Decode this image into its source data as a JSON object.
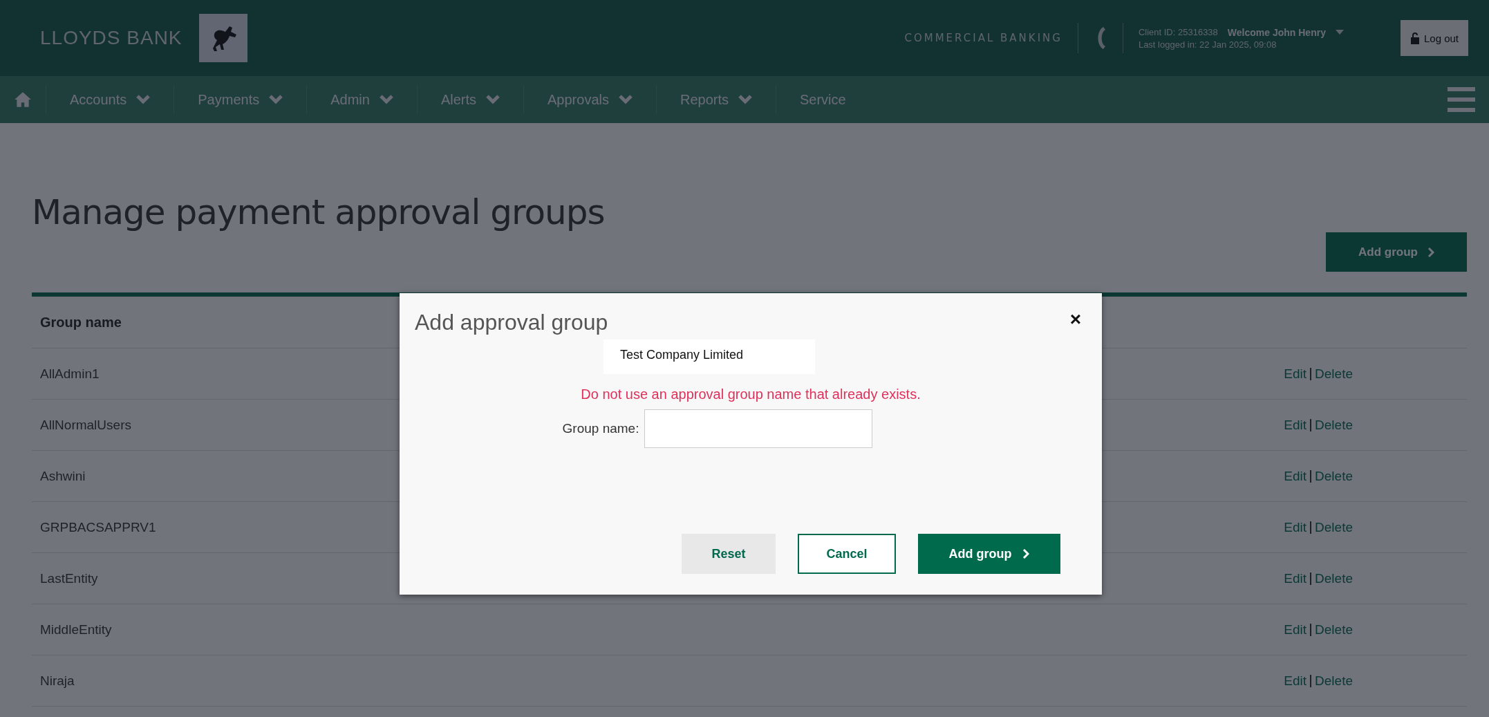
{
  "header": {
    "brand": "LLOYDS BANK",
    "segment": "COMMERCIAL BANKING",
    "client_id": "Client ID: 25316338",
    "welcome": "Welcome John Henry",
    "last_logged": "Last logged in: 22 Jan 2025, 09:08",
    "logout": "Log out"
  },
  "nav": [
    {
      "label": "Accounts",
      "dropdown": true
    },
    {
      "label": "Payments",
      "dropdown": true
    },
    {
      "label": "Admin",
      "dropdown": true
    },
    {
      "label": "Alerts",
      "dropdown": true
    },
    {
      "label": "Approvals",
      "dropdown": true
    },
    {
      "label": "Reports",
      "dropdown": true
    },
    {
      "label": "Service",
      "dropdown": false
    }
  ],
  "page": {
    "title": "Manage payment approval groups",
    "add_button": "Add group"
  },
  "table": {
    "columns": [
      "Group name"
    ],
    "rows": [
      {
        "name": "AllAdmin1",
        "edit": "Edit",
        "delete": "Delete"
      },
      {
        "name": "AllNormalUsers",
        "edit": "Edit",
        "delete": "Delete"
      },
      {
        "name": "Ashwini",
        "edit": "Edit",
        "delete": "Delete"
      },
      {
        "name": "GRPBACSAPPRV1",
        "edit": "Edit",
        "delete": "Delete"
      },
      {
        "name": "LastEntity",
        "edit": "Edit",
        "delete": "Delete"
      },
      {
        "name": "MiddleEntity",
        "edit": "Edit",
        "delete": "Delete"
      },
      {
        "name": "Niraja",
        "edit": "Edit",
        "delete": "Delete"
      }
    ]
  },
  "dialog": {
    "title": "Add approval group",
    "close": "×",
    "company": "Test Company Limited",
    "warning": "Do not use an approval group name that already exists.",
    "field_label": "Group name:",
    "buttons": [
      {
        "label": "Reset",
        "kind": "secondary"
      },
      {
        "label": "Cancel",
        "kind": "outline"
      },
      {
        "label": "Add group",
        "kind": "primary"
      }
    ]
  }
}
